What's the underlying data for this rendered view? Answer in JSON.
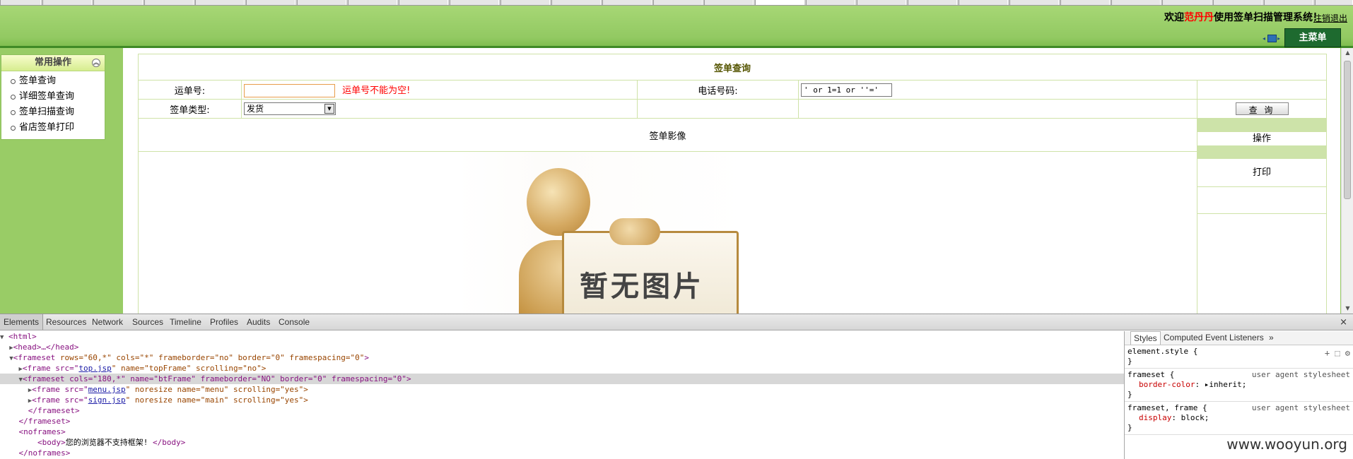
{
  "header": {
    "welcome_prefix": "欢迎",
    "user_name": "范丹丹",
    "welcome_suffix": "使用签单扫描管理系统！",
    "logout": "注销退出",
    "main_menu": "主菜单"
  },
  "sidebar": {
    "title": "常用操作",
    "items": [
      {
        "label": "签单查询"
      },
      {
        "label": "详细签单查询"
      },
      {
        "label": "签单扫描查询"
      },
      {
        "label": "省店签单打印"
      }
    ]
  },
  "main": {
    "caption": "签单查询",
    "waybill_label": "运单号:",
    "waybill_value": "",
    "waybill_error": "运单号不能为空!",
    "phone_label": "电话号码:",
    "phone_value": "' or 1=1 or ''='",
    "type_label": "签单类型:",
    "type_value": "发货",
    "query_button": "查 询",
    "image_title": "签单影像",
    "operation_label": "操作",
    "print_label": "打印",
    "placeholder_text": "暂无图片"
  },
  "devtools": {
    "tabs": [
      "Elements",
      "Resources",
      "Network",
      "Sources",
      "Timeline",
      "Profiles",
      "Audits",
      "Console"
    ],
    "close": "×",
    "dom": {
      "l1": "<html>",
      "l2_tag": "<head>…</head>",
      "l3_open": "<frameset ",
      "l3_attrs": "rows=\"60,*\" cols=\"*\" frameborder=\"no\" border=\"0\" framespacing=\"0\"",
      "l3_close": ">",
      "l4_pre": "<frame src=\"",
      "l4_link": "top.jsp",
      "l4_post": "\" name=\"topFrame\" scrolling=\"no\">",
      "l5": "<frameset cols=\"180,*\" name=\"btFrame\" frameborder=\"NO\" border=\"0\" framespacing=\"0\">",
      "l6_pre": "<frame src=\"",
      "l6_link": "menu.jsp",
      "l6_post": "\" noresize name=\"menu\" scrolling=\"yes\">",
      "l7_pre": "<frame src=\"",
      "l7_link": "sign.jsp",
      "l7_post": "\" noresize name=\"main\" scrolling=\"yes\">",
      "l8": "</frameset>",
      "l9": "</frameset>",
      "l10": "<noframes>",
      "l11_open": "<body>",
      "l11_text": "您的浏览器不支持框架!",
      "l11_close": " </body>",
      "l12": "</noframes>"
    },
    "styles": {
      "tabs": [
        "Styles",
        "Computed",
        "Event Listeners"
      ],
      "more": "»",
      "icons": "+ ⬚ ⚙",
      "rule1_selector": "element.style {",
      "rule1_close": "}",
      "rule2_selector": "frameset {",
      "rule2_source": "user agent stylesheet",
      "rule2_prop": "border-color",
      "rule2_value": "▸inherit;",
      "rule2_close": "}",
      "rule3_selector": "frameset, frame {",
      "rule3_source": "user agent stylesheet",
      "rule3_prop": "display",
      "rule3_value": "block;",
      "rule3_close": "}"
    }
  },
  "watermark": "www.wooyun.org"
}
